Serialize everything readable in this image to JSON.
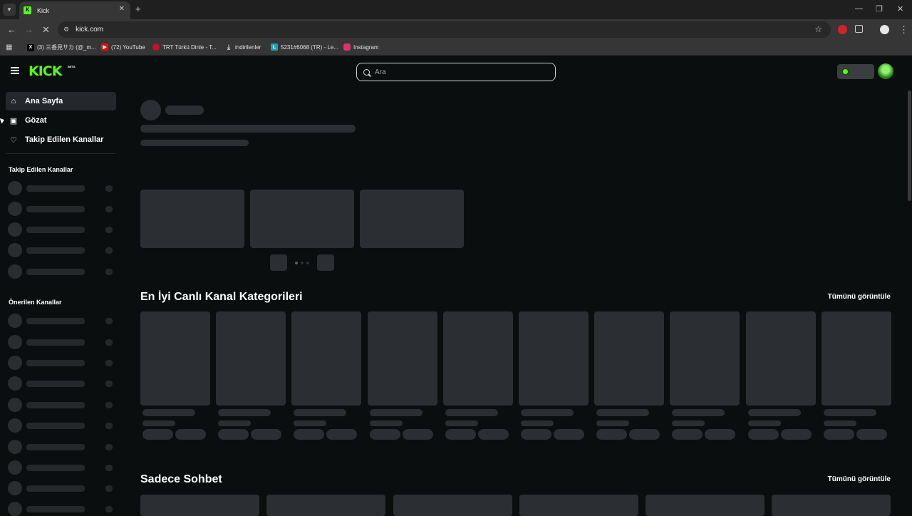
{
  "browser": {
    "tab_title": "Kick",
    "tab_favicon": "K",
    "url": "kick.com",
    "bookmarks": [
      {
        "label": "(3) 三香見サカ (@_m...",
        "icon": "x-logo-icon",
        "color": "#000000"
      },
      {
        "label": "(72) YouTube",
        "icon": "youtube-icon",
        "color": "#ff0000"
      },
      {
        "label": "TRT Türkü Dinle - T...",
        "icon": "trt-icon",
        "color": "#c8102e"
      },
      {
        "label": "indirilenler",
        "icon": "download-icon",
        "color": "#363636"
      },
      {
        "label": "5231#6068 (TR) - Le...",
        "icon": "league-icon",
        "color": "#1ba1c4"
      },
      {
        "label": "Instagram",
        "icon": "instagram-icon",
        "color": "#e1306c"
      }
    ]
  },
  "header": {
    "logo": "KICK",
    "logo_badge": "BETA",
    "search_placeholder": "Ara",
    "accent": "#53fc18"
  },
  "sidebar": {
    "nav": [
      {
        "label": "Ana Sayfa",
        "icon": "home-icon"
      },
      {
        "label": "Gözat",
        "icon": "browse-icon"
      },
      {
        "label": "Takip Edilen Kanallar",
        "icon": "heart-icon"
      }
    ],
    "following_heading": "Takip Edilen Kanallar",
    "recommended_heading": "Önerilen Kanallar"
  },
  "main": {
    "categories_title": "En İyi Canlı Kanal Kategorileri",
    "categories_view_all": "Tümünü görüntüle",
    "chat_title": "Sadece Sohbet",
    "chat_view_all": "Tümünü görüntüle"
  }
}
